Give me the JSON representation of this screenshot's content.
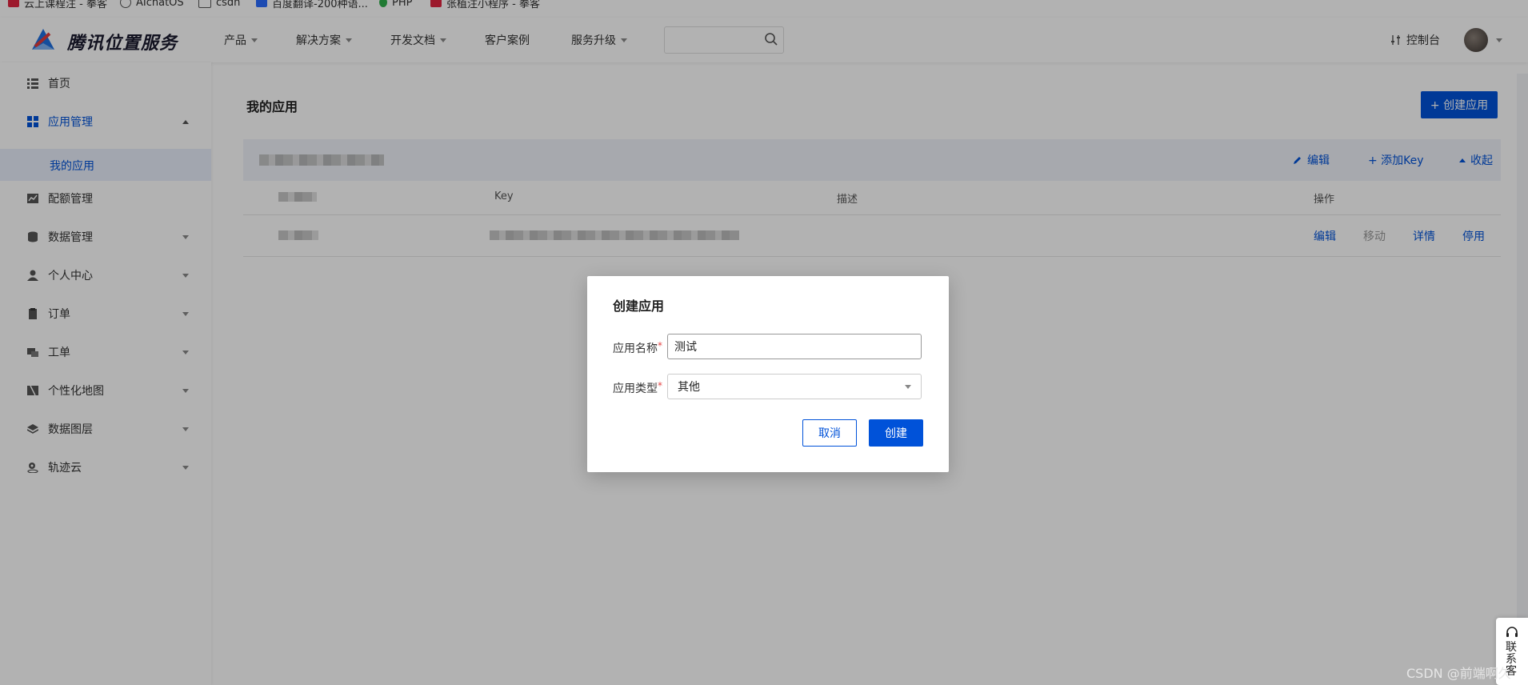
{
  "bookmarks": [
    {
      "label": "云上课程注 - 拳客",
      "color": "#e0243f"
    },
    {
      "label": "AIchatOS",
      "color": "#555555"
    },
    {
      "label": "csdn",
      "color": "#555555"
    },
    {
      "label": "百度翻译-200种语...",
      "color": "#2a6cff"
    },
    {
      "label": "PHP",
      "color": "#2eaf4a"
    },
    {
      "label": "张植注小程序 - 拳客",
      "color": "#e0243f"
    }
  ],
  "header": {
    "brand": "腾讯位置服务",
    "nav": [
      {
        "label": "产品",
        "has_caret": true
      },
      {
        "label": "解决方案",
        "has_caret": true
      },
      {
        "label": "开发文档",
        "has_caret": true
      },
      {
        "label": "客户案例",
        "has_caret": false
      },
      {
        "label": "服务升级",
        "has_caret": true
      }
    ],
    "search_placeholder": "",
    "console_label": "控制台"
  },
  "sidebar": {
    "items": [
      {
        "label": "首页",
        "icon": "list-icon"
      },
      {
        "label": "应用管理",
        "icon": "grid-icon",
        "expanded": true
      },
      {
        "label": "配额管理",
        "icon": "chart-icon"
      },
      {
        "label": "数据管理",
        "icon": "database-icon"
      },
      {
        "label": "个人中心",
        "icon": "user-icon"
      },
      {
        "label": "订单",
        "icon": "clipboard-icon"
      },
      {
        "label": "工单",
        "icon": "ticket-icon"
      },
      {
        "label": "个性化地图",
        "icon": "map-icon"
      },
      {
        "label": "数据图层",
        "icon": "layers-icon"
      },
      {
        "label": "轨迹云",
        "icon": "location-icon"
      }
    ],
    "sub_item": "我的应用"
  },
  "main": {
    "title": "我的应用",
    "create_button": "+ 创建应用",
    "group_actions": {
      "edit": "编辑",
      "add_key": "+ 添加Key",
      "collapse": "收起"
    },
    "table_headers": [
      "Key",
      "描述",
      "操作"
    ],
    "row_actions": [
      "编辑",
      "移动",
      "详情",
      "停用"
    ]
  },
  "modal": {
    "title": "创建应用",
    "name_label": "应用名称",
    "name_value": "测试",
    "type_label": "应用类型",
    "type_value": "其他",
    "cancel": "取消",
    "create": "创建"
  },
  "contact": {
    "label": "联系客"
  },
  "watermark": "CSDN @前端啊久",
  "colors": {
    "primary": "#0052d9",
    "required": "#e54545"
  }
}
